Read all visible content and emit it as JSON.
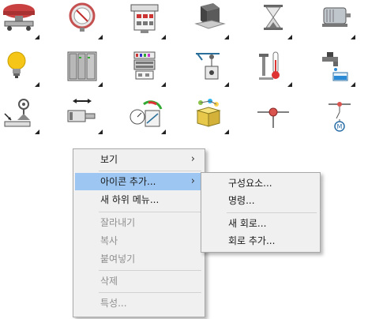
{
  "icons": [
    {
      "name": "emergency-stop-icon"
    },
    {
      "name": "gauge-dial-icon"
    },
    {
      "name": "terminal-block-icon"
    },
    {
      "name": "cube-block-icon"
    },
    {
      "name": "hourglass-icon"
    },
    {
      "name": "electric-motor-icon"
    },
    {
      "name": "light-bulb-icon"
    },
    {
      "name": "cabinet-rack-icon"
    },
    {
      "name": "plc-module-icon"
    },
    {
      "name": "crane-hoist-icon"
    },
    {
      "name": "thermometer-icon"
    },
    {
      "name": "water-faucet-icon"
    },
    {
      "name": "antenna-sensor-icon"
    },
    {
      "name": "linear-actuator-icon"
    },
    {
      "name": "instrument-panel-icon"
    },
    {
      "name": "component-box-icon"
    },
    {
      "name": "connection-node-icon"
    },
    {
      "name": "motor-circuit-icon"
    }
  ],
  "context_menu": {
    "items": [
      {
        "label": "보기",
        "submenu": true
      },
      {
        "label": "아이콘 추가...",
        "submenu": true,
        "highlighted": true
      },
      {
        "label": "새 하위 메뉴..."
      },
      {
        "label": "잘라내기",
        "disabled": true
      },
      {
        "label": "복사",
        "disabled": true
      },
      {
        "label": "붙여넣기",
        "disabled": true
      },
      {
        "label": "삭제",
        "disabled": true
      },
      {
        "label": "특성...",
        "disabled": true
      }
    ],
    "submenu_arrow": "›"
  },
  "submenu": {
    "items": [
      {
        "label": "구성요소..."
      },
      {
        "label": "명령..."
      },
      {
        "label": "새 회로..."
      },
      {
        "label": "회로 추가..."
      }
    ]
  }
}
